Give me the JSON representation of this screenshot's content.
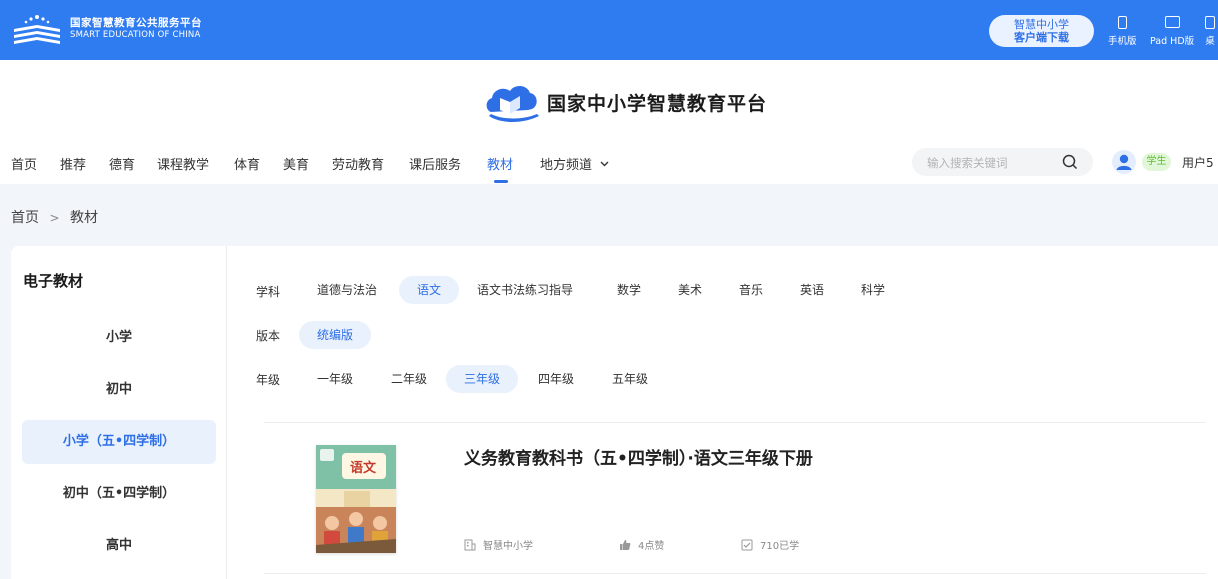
{
  "header": {
    "logo_cn": "国家智慧教育公共服务平台",
    "logo_en": "SMART EDUCATION OF CHINA",
    "download_line1": "智慧中小学",
    "download_line2": "客户端下载",
    "devices": [
      "手机版",
      "Pad HD版",
      "桌"
    ]
  },
  "brand": {
    "title": "国家中小学智慧教育平台"
  },
  "nav": {
    "items": [
      "首页",
      "推荐",
      "德育",
      "课程教学",
      "体育",
      "美育",
      "劳动教育",
      "课后服务",
      "教材",
      "地方频道"
    ],
    "active": "教材",
    "search_placeholder": "输入搜索关键词",
    "user_badge": "学生",
    "user_name": "用户5"
  },
  "breadcrumb": {
    "home": "首页",
    "sep": ">",
    "current": "教材"
  },
  "sidebar": {
    "title": "电子教材",
    "items": [
      "小学",
      "初中",
      "小学（五•四学制）",
      "初中（五•四学制）",
      "高中"
    ],
    "active": "小学（五•四学制）"
  },
  "filters": {
    "subject_label": "学科",
    "subjects": [
      "道德与法治",
      "语文",
      "语文书法练习指导",
      "数学",
      "美术",
      "音乐",
      "英语",
      "科学"
    ],
    "subject_active": "语文",
    "edition_label": "版本",
    "editions": [
      "统编版"
    ],
    "edition_active": "统编版",
    "grade_label": "年级",
    "grades": [
      "一年级",
      "二年级",
      "三年级",
      "四年级",
      "五年级"
    ],
    "grade_active": "三年级"
  },
  "book": {
    "title": "义务教育教科书（五•四学制）·语文三年级下册",
    "publisher": "智慧中小学",
    "likes": "4点赞",
    "learned": "710已学",
    "cover_text": "语文"
  },
  "colors": {
    "primary": "#2f7bf0",
    "accent": "#2f6fe6",
    "chip_bg": "#e9f1fd"
  }
}
